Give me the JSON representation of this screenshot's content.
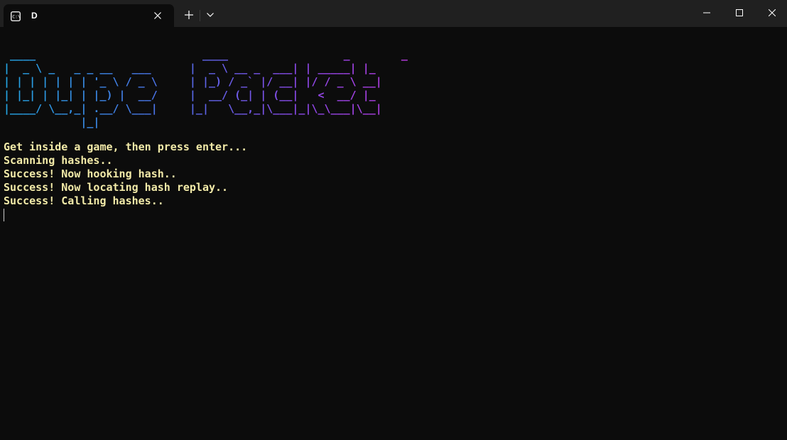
{
  "window": {
    "tab_title": "D",
    "tab_icon": "terminal-icon",
    "close_tab_icon": "close-icon",
    "new_tab_icon": "plus-icon",
    "dropdown_icon": "chevron-down-icon",
    "minimize_icon": "minimize-icon",
    "maximize_icon": "maximize-icon",
    "close_window_icon": "close-icon"
  },
  "console": {
    "banner_ascii": " ____                          ____                  _        _   \n|  _ \\ _   _ _ __   ___      |  _ \\ __ _  ___| | _____| |_ \n| | | | | | | '_ \\ / _ \\     | |_) / _` |/ __| |/ / _ \\ __|\n| |_| | |_| | |_) |  __/     |  __/ (_| | (__|   <  __/ |_ \n|____/ \\__,_| .__/ \\___|     |_|   \\__,_|\\___|_|\\_\\___|\\__|\n            |_|                                              ",
    "lines": [
      "Get inside a game, then press enter...",
      "Scanning hashes..",
      "Success! Now hooking hash..",
      "Success! Now locating hash replay..",
      "Success! Calling hashes.."
    ]
  },
  "colors": {
    "background": "#0c0c0c",
    "titlebar": "#202020",
    "text": "#f2eaa8",
    "banner_gradient": [
      "#23a8e6",
      "#4f6ee8",
      "#8b48e8",
      "#c23ae0"
    ]
  }
}
